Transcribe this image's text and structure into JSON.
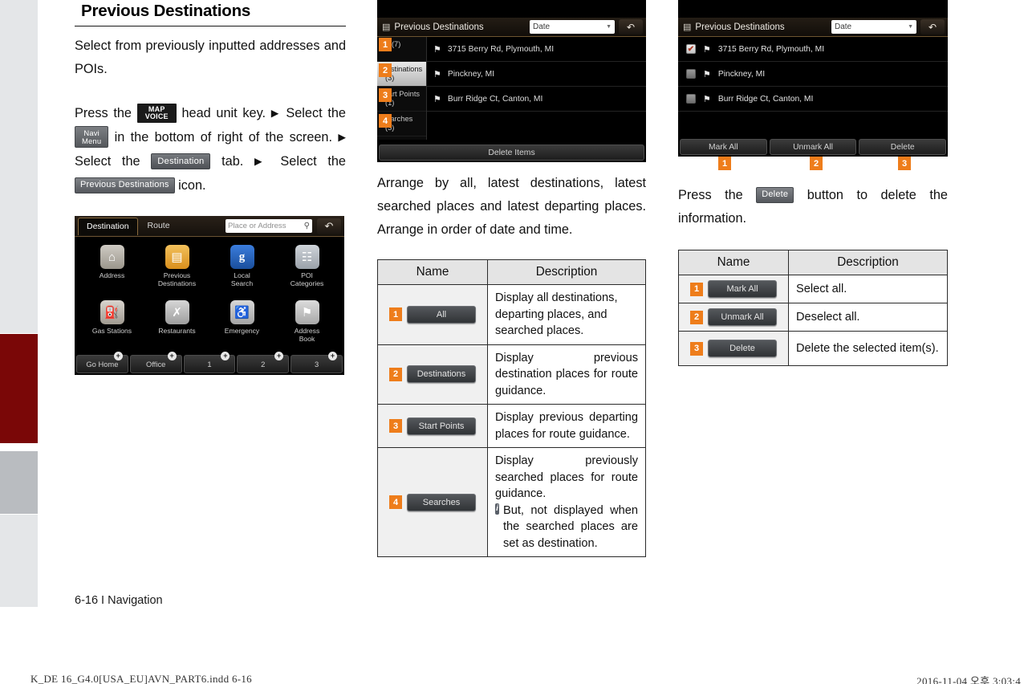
{
  "left": {
    "title": "Previous Destinations",
    "intro": "Select from previously inputted addresses and POIs.",
    "steps": {
      "t1": "Press the",
      "key_map_line1": "MAP",
      "key_map_line2": "VOICE",
      "t2": "head unit key.",
      "arrow": "▶",
      "t3": "Select the",
      "key_navi_line1": "Navi",
      "key_navi_line2": "Menu",
      "t4": "in the bottom of right of the screen.",
      "t5": "Select the",
      "key_destination": "Destination",
      "t6": "tab.",
      "t7": "Select the",
      "key_prev_dest": "Previous Destinations",
      "t8": "icon."
    },
    "nav_screen": {
      "tabs": [
        "Destination",
        "Route"
      ],
      "active_tab": "Destination",
      "search_placeholder": "Place or Address",
      "search_icon": "search-icon",
      "back_icon": "↶",
      "icons": [
        {
          "label": "Address",
          "glyph": "⌂",
          "cls": "ic-home"
        },
        {
          "label": "Previous\nDestinations",
          "glyph": "▤",
          "cls": "ic-prev"
        },
        {
          "label": "Local\nSearch",
          "glyph": "g",
          "cls": "ic-goog"
        },
        {
          "label": "POI\nCategories",
          "glyph": "☷",
          "cls": "ic-poi"
        },
        {
          "label": "Gas Stations",
          "glyph": "⛽",
          "cls": "ic-gas"
        },
        {
          "label": "Restaurants",
          "glyph": "✗",
          "cls": "ic-rest"
        },
        {
          "label": "Emergency",
          "glyph": "⊕",
          "cls": "ic-emer"
        },
        {
          "label": "Address\nBook",
          "glyph": "⚑",
          "cls": "ic-book"
        }
      ],
      "shortcuts": [
        "Go Home",
        "Office",
        "1",
        "2",
        "3"
      ],
      "plus": "+"
    },
    "page_footer": "6-16 I Navigation"
  },
  "middle": {
    "screen": {
      "header_icon": "list-icon",
      "header_title": "Previous Destinations",
      "sort_value": "Date",
      "sort_caret": "▼",
      "back_icon": "↶",
      "categories": [
        {
          "name": "All",
          "count": "(7)",
          "selected": false
        },
        {
          "name": "Destinations",
          "count": "(3)",
          "selected": true
        },
        {
          "name": "Start Points",
          "count": "(1)",
          "selected": false
        },
        {
          "name": "Searches",
          "count": "(3)",
          "selected": false
        }
      ],
      "items": [
        "3715 Berry Rd, Plymouth, MI",
        "Pinckney, MI",
        "Burr Ridge Ct, Canton, MI"
      ],
      "flag_icon": "⚑",
      "delete_items_label": "Delete Items",
      "markers": [
        "1",
        "2",
        "3",
        "4"
      ]
    },
    "paragraph": "Arrange by all, latest destinations, latest searched places and latest departing places. Arrange in order of date and time.",
    "table": {
      "headers": [
        "Name",
        "Description"
      ],
      "rows": [
        {
          "marker": "1",
          "button": "All",
          "desc": "Display all destinations, departing places, and searched places."
        },
        {
          "marker": "2",
          "button": "Destinations",
          "desc": "Display previous destination places for route guidance."
        },
        {
          "marker": "3",
          "button": "Start Points",
          "desc": "Display previous departing places for route guidance."
        },
        {
          "marker": "4",
          "button": "Searches",
          "desc": "Display previously searched places for route guidance.",
          "note_icon": "i",
          "note": "But, not displayed when the searched places are set as destination."
        }
      ]
    }
  },
  "right": {
    "screen": {
      "header_icon": "list-icon",
      "header_title": "Previous Destinations",
      "sort_value": "Date",
      "sort_caret": "▼",
      "back_icon": "↶",
      "flag_icon": "⚑",
      "check_glyph": "✔",
      "items": [
        {
          "label": "3715 Berry Rd, Plymouth, MI",
          "checked": true
        },
        {
          "label": "Pinckney, MI",
          "checked": false
        },
        {
          "label": "Burr Ridge Ct, Canton, MI",
          "checked": false
        }
      ],
      "buttons": [
        "Mark All",
        "Unmark All",
        "Delete"
      ],
      "markers": [
        "1",
        "2",
        "3"
      ]
    },
    "paragraph_pre": "Press the",
    "paragraph_btn": "Delete",
    "paragraph_post": "button to delete the information.",
    "table": {
      "headers": [
        "Name",
        "Description"
      ],
      "rows": [
        {
          "marker": "1",
          "button": "Mark All",
          "desc": "Select all."
        },
        {
          "marker": "2",
          "button": "Unmark All",
          "desc": "Deselect all."
        },
        {
          "marker": "3",
          "button": "Delete",
          "desc": "Delete the selected item(s)."
        }
      ]
    }
  },
  "print": {
    "file": "K_DE 16_G4.0[USA_EU]AVN_PART6.indd   6-16",
    "stamp": "2016-11-04   오후 3:03:4"
  },
  "colors": {
    "marker_orange": "#ee7d1b",
    "tab_red": "#7a0707",
    "tab_gray": "#b9bcc0",
    "tab_light": "#e4e6e8"
  }
}
